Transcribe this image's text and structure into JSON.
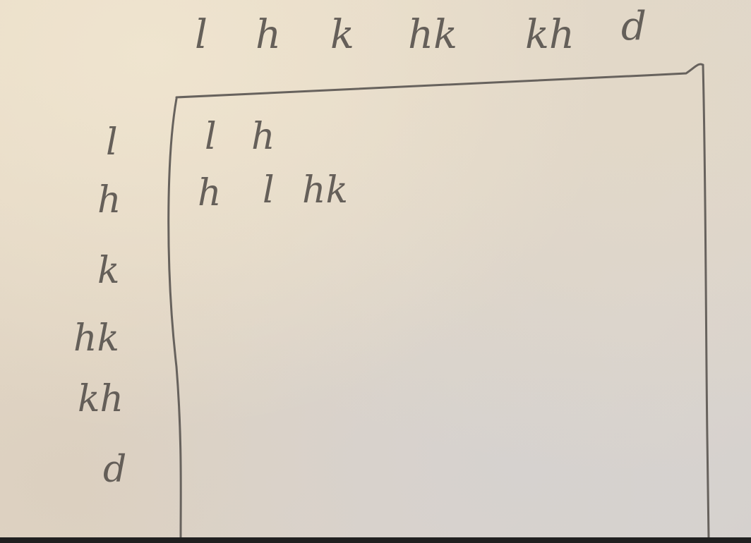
{
  "table": {
    "column_headers": [
      "l",
      "h",
      "k",
      "hk",
      "kh",
      "d"
    ],
    "row_headers": [
      "l",
      "h",
      "k",
      "hk",
      "kh",
      "d"
    ],
    "rows": [
      [
        "l",
        "h",
        "",
        "",
        "",
        ""
      ],
      [
        "h",
        "l",
        "hk",
        "",
        "",
        ""
      ],
      [
        "",
        "",
        "",
        "",
        "",
        ""
      ],
      [
        "",
        "",
        "",
        "",
        "",
        ""
      ],
      [
        "",
        "",
        "",
        "",
        "",
        ""
      ],
      [
        "",
        "",
        "",
        "",
        "",
        ""
      ]
    ]
  },
  "colors": {
    "paper": "#e6dccb",
    "ink": "#5a5550"
  }
}
